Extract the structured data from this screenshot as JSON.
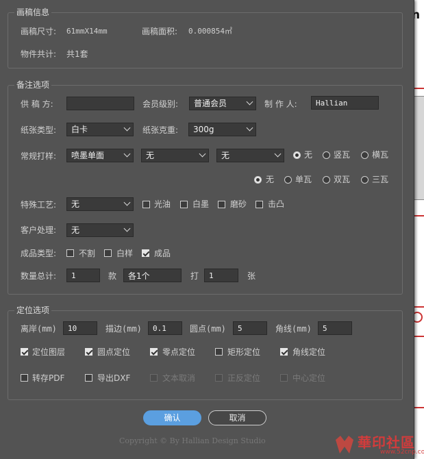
{
  "draft_info": {
    "legend": "画稿信息",
    "size_label": "画稿尺寸:",
    "size_value": "61mmX14mm",
    "area_label": "画稿面积:",
    "area_value": "0.000854㎡",
    "count_label": "物件共计:",
    "count_value": "共1套"
  },
  "notes": {
    "legend": "备注选项",
    "supplier_label": "供 稿 方:",
    "supplier_value": "",
    "member_label": "会员级别:",
    "member_value": "普通会员",
    "author_label": "制 作 人:",
    "author_value": "Hallian",
    "paper_type_label": "纸张类型:",
    "paper_type_value": "白卡",
    "paper_weight_label": "纸张克重:",
    "paper_weight_value": "300g",
    "print_label": "常规打样:",
    "print_value_1": "喷墨单面",
    "print_value_2": "无",
    "print_value_3": "无",
    "radio_row1": [
      "无",
      "竖瓦",
      "横瓦"
    ],
    "radio_row2": [
      "无",
      "单瓦",
      "双瓦",
      "三瓦"
    ],
    "special_label": "特殊工艺:",
    "special_value": "无",
    "special_options": [
      "光油",
      "白墨",
      "磨砂",
      "击凸"
    ],
    "client_label": "客户处理:",
    "client_value": "无",
    "product_label": "成品类型:",
    "product_options": [
      "不割",
      "白样",
      "成品"
    ],
    "product_checked": [
      false,
      false,
      true
    ],
    "qty_label": "数量总计:",
    "qty_value": "1",
    "kind_label": "款",
    "kind_value": "各1个",
    "hit_label": "打",
    "hit_value": "1",
    "sheet_label": "张"
  },
  "positioning": {
    "legend": "定位选项",
    "offset_label": "离岸(mm)",
    "offset_value": "10",
    "stroke_label": "描边(mm)",
    "stroke_value": "0.1",
    "dot_label": "圆点(mm)",
    "dot_value": "5",
    "corner_label": "角线(mm)",
    "corner_value": "5",
    "row1": [
      "定位图层",
      "圆点定位",
      "零点定位",
      "矩形定位",
      "角线定位"
    ],
    "row1_checked": [
      true,
      true,
      true,
      false,
      true
    ],
    "row2": [
      "转存PDF",
      "导出DXF",
      "文本取消",
      "正反定位",
      "中心定位"
    ],
    "row2_enabled": [
      true,
      true,
      false,
      false,
      false
    ]
  },
  "buttons": {
    "ok": "确认",
    "cancel": "取消"
  },
  "copyright": "Copyright © By Hallian Design Studio",
  "watermark": {
    "text": "華印社區",
    "url": "www.52cnp.com"
  },
  "background_doc": {
    "partial_text": "n"
  }
}
